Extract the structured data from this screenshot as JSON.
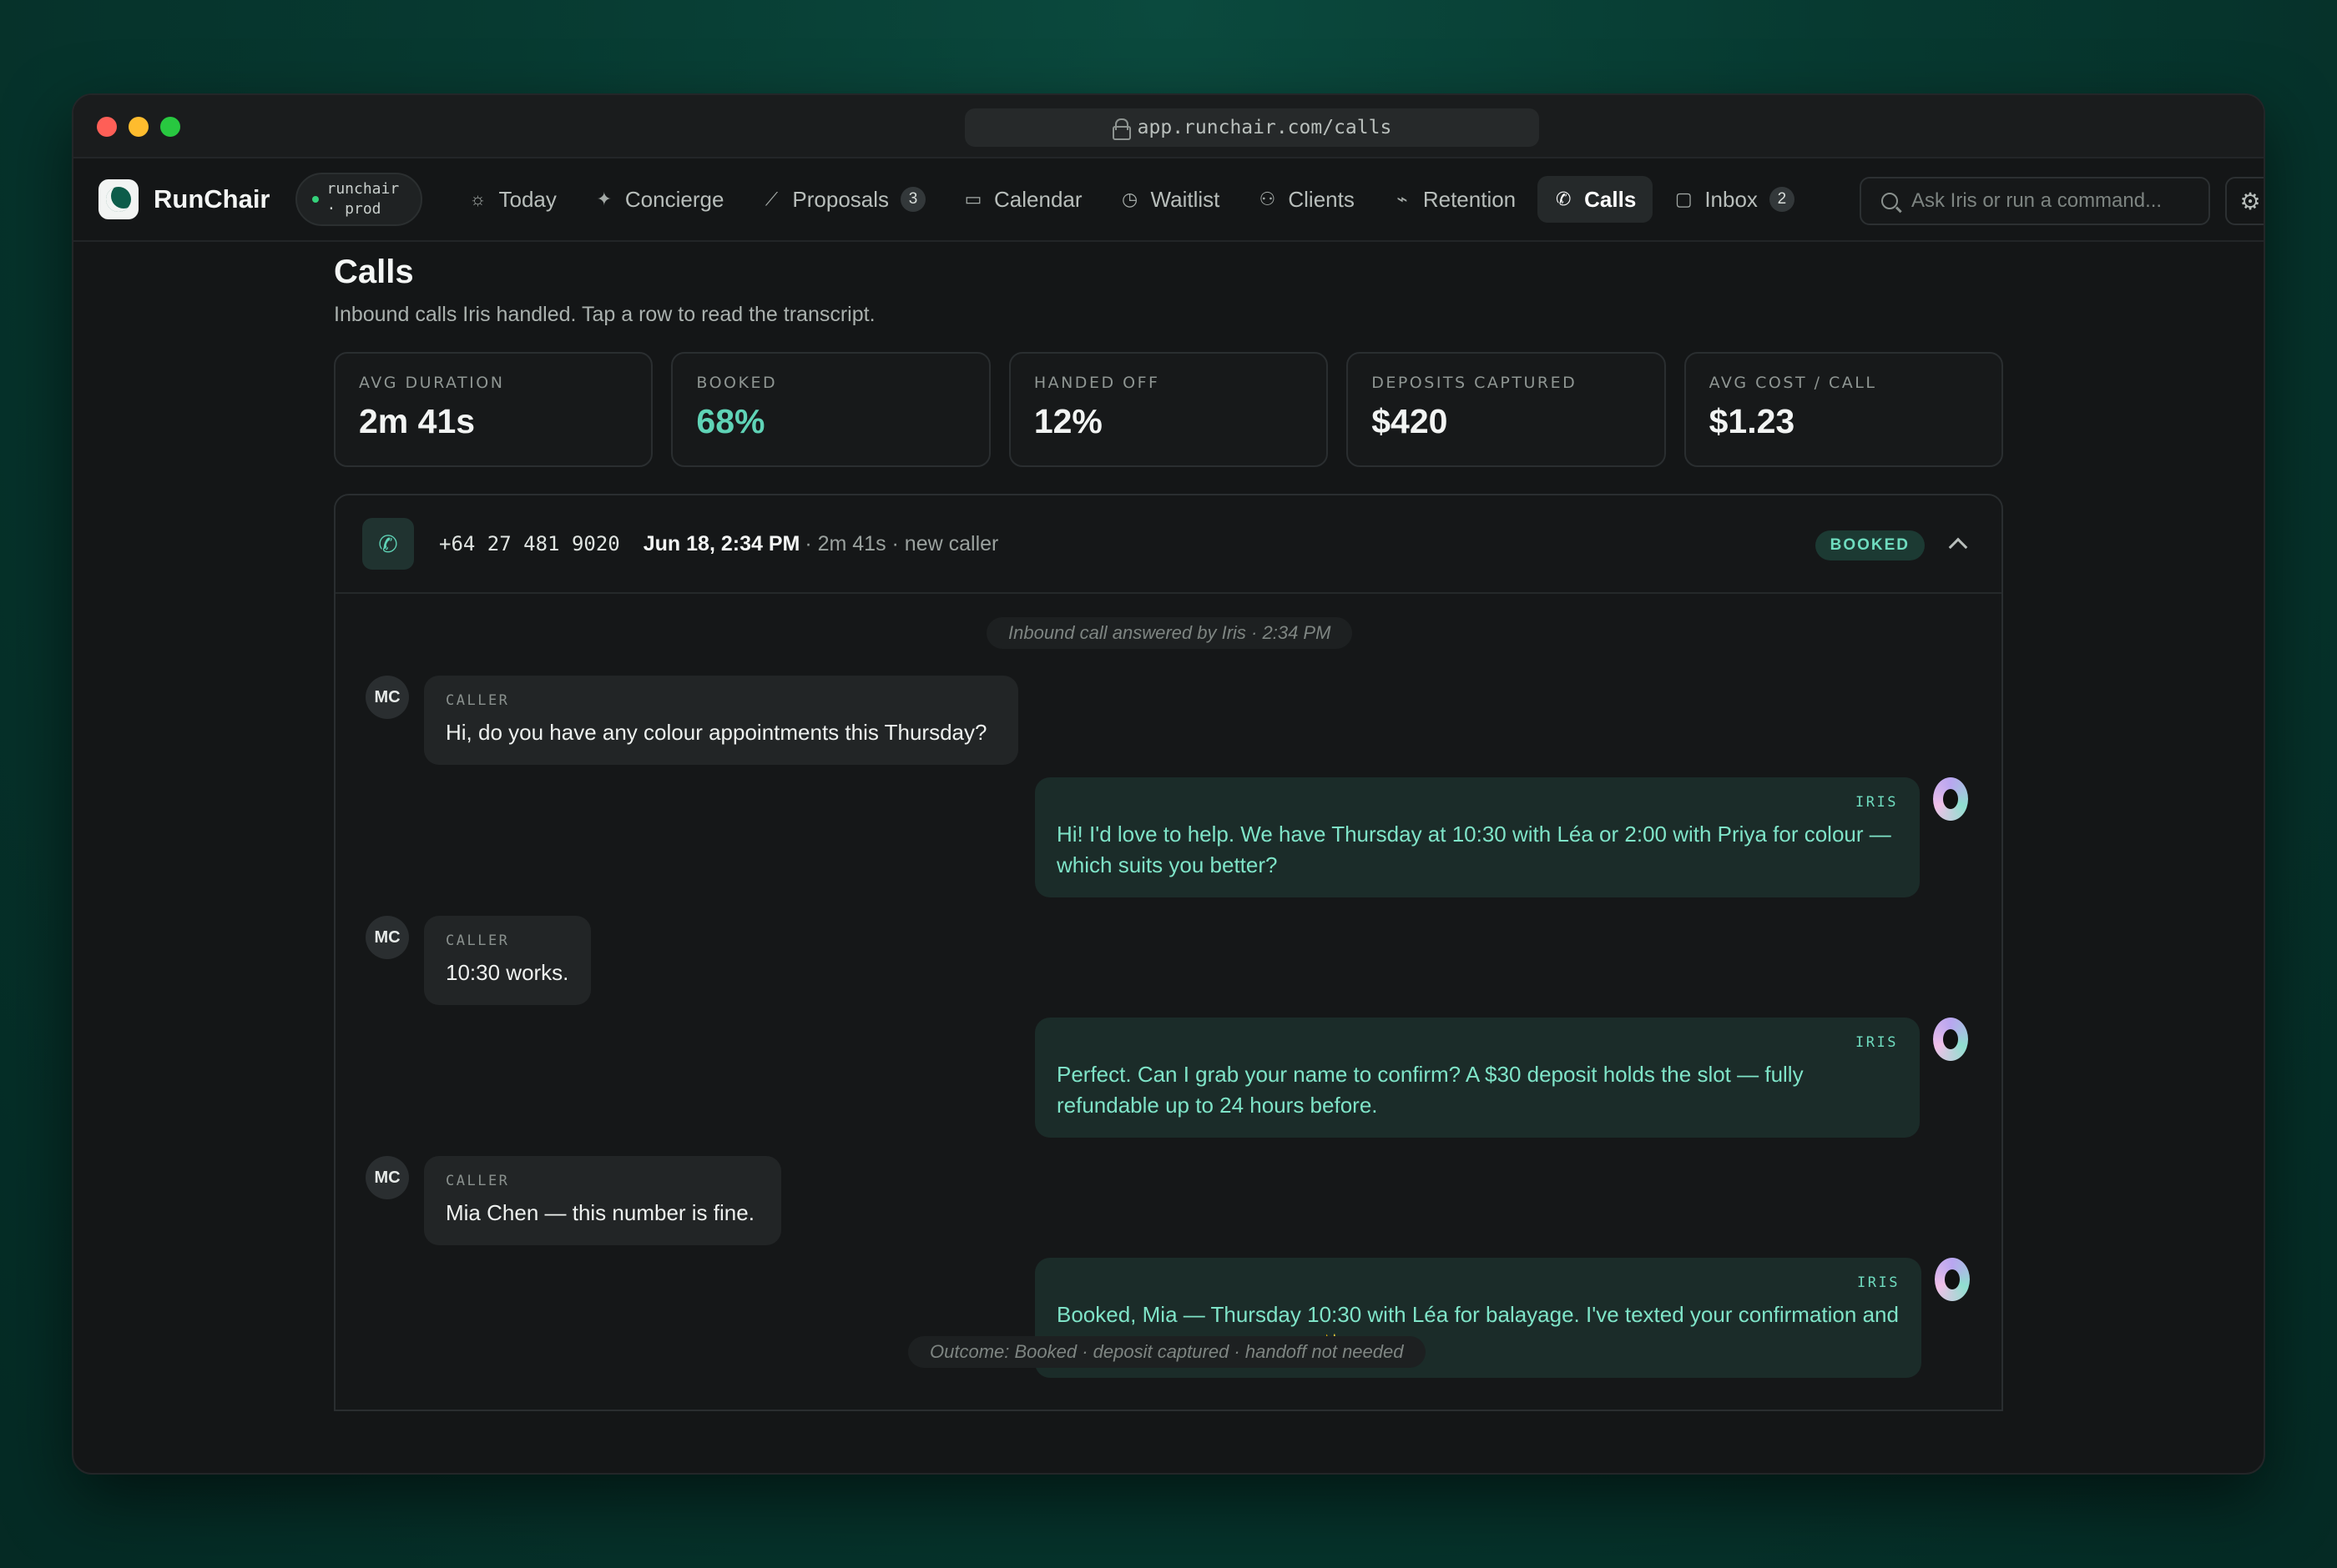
{
  "browser": {
    "url": "app.runchair.com/calls"
  },
  "nav": {
    "brand": "RunChair",
    "env": "runchair · prod",
    "items": [
      {
        "label": "Today",
        "icon": "sun-icon",
        "glyph": "☼"
      },
      {
        "label": "Concierge",
        "icon": "sparkle-icon",
        "glyph": "✦"
      },
      {
        "label": "Proposals",
        "icon": "trend-icon",
        "glyph": "⟋",
        "badge": "3"
      },
      {
        "label": "Calendar",
        "icon": "calendar-icon",
        "glyph": "▭"
      },
      {
        "label": "Waitlist",
        "icon": "clock-icon",
        "glyph": "◷"
      },
      {
        "label": "Clients",
        "icon": "users-icon",
        "glyph": "⚇"
      },
      {
        "label": "Retention",
        "icon": "pulse-icon",
        "glyph": "⌁"
      },
      {
        "label": "Calls",
        "icon": "phone-icon",
        "glyph": "✆",
        "active": true
      },
      {
        "label": "Inbox",
        "icon": "message-icon",
        "glyph": "▢",
        "badge": "2"
      }
    ],
    "search_placeholder": "Ask Iris or run a command..."
  },
  "page": {
    "title": "Calls",
    "subtitle": "Inbound calls Iris handled. Tap a row to read the transcript."
  },
  "stats": [
    {
      "label": "AVG DURATION",
      "value": "2m 41s"
    },
    {
      "label": "BOOKED",
      "value": "68%",
      "accent": "#5fd3b6"
    },
    {
      "label": "HANDED OFF",
      "value": "12%"
    },
    {
      "label": "DEPOSITS CAPTURED",
      "value": "$420"
    },
    {
      "label": "AVG COST / CALL",
      "value": "$1.23"
    }
  ],
  "call": {
    "phone": "+64 27 481 9020",
    "date": "Jun 18, 2:34 PM",
    "meta": "· 2m 41s · new caller",
    "status": "BOOKED",
    "start_note": "Inbound call answered by Iris · 2:34 PM",
    "end_note": "Outcome: Booked · deposit captured · handoff not needed",
    "caller_initials": "MC",
    "caller_role": "CALLER",
    "iris_role": "IRIS",
    "messages": [
      {
        "from": "caller",
        "text": "Hi, do you have any colour appointments this Thursday?"
      },
      {
        "from": "iris",
        "text": "Hi! I'd love to help. We have Thursday at 10:30 with Léa or 2:00 with Priya for colour — which suits you better?"
      },
      {
        "from": "caller",
        "text": "10:30 works."
      },
      {
        "from": "iris",
        "text": "Perfect. Can I grab your name to confirm? A $30 deposit holds the slot — fully refundable up to 24 hours before."
      },
      {
        "from": "caller",
        "text": "Mia Chen — this number is fine."
      },
      {
        "from": "iris",
        "text": "Booked, Mia — Thursday 10:30 with Léa for balayage. I've texted your confirmation and deposit link. See you then! ✨"
      }
    ]
  }
}
